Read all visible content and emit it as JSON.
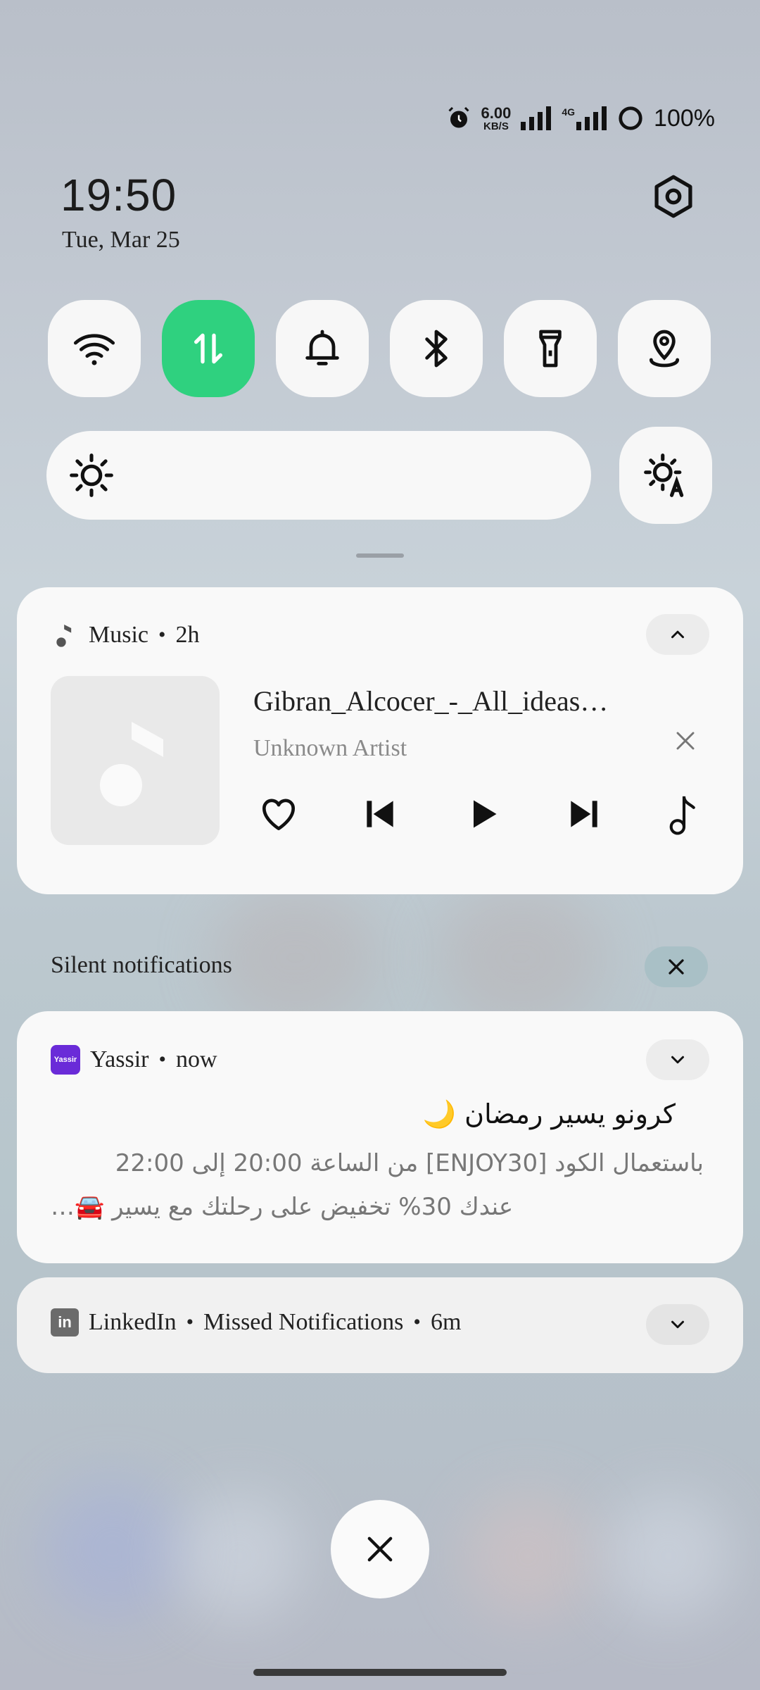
{
  "status": {
    "speed_value": "6.00",
    "speed_unit": "KB/S",
    "network": "4G",
    "battery": "100%"
  },
  "clock": {
    "time": "19:50",
    "date": "Tue, Mar 25"
  },
  "quick_tiles": [
    {
      "icon": "wifi-icon",
      "active": false
    },
    {
      "icon": "mobile-data-icon",
      "active": true
    },
    {
      "icon": "bell-icon",
      "active": false
    },
    {
      "icon": "bluetooth-icon",
      "active": false
    },
    {
      "icon": "flashlight-icon",
      "active": false
    },
    {
      "icon": "location-icon",
      "active": false
    }
  ],
  "brightness": {
    "icon": "sun-icon",
    "auto_icon": "auto-brightness-icon"
  },
  "music": {
    "app": "Music",
    "age": "2h",
    "song": "Gibran_Alcocer_-_All_ideas…",
    "artist": "Unknown Artist"
  },
  "silent": {
    "label": "Silent notifications"
  },
  "yassir": {
    "app": "Yassir",
    "age": "now",
    "icon_text": "Yassir",
    "title": "كرونو يسير رمضان",
    "title_emoji": "🌙",
    "line1": "باستعمال الكود [ENJOY30] من الساعة 20:00 إلى 22:00",
    "line2": "عندك 30% تخفيض على رحلتك مع يسير 🚘…"
  },
  "linkedin": {
    "app": "LinkedIn",
    "channel": "Missed Notifications",
    "age": "6m",
    "icon_text": "in"
  },
  "colors": {
    "accent_green": "#2fd17f",
    "yassir_purple": "#6a2bd8",
    "card_bg": "#f9f9f9"
  }
}
